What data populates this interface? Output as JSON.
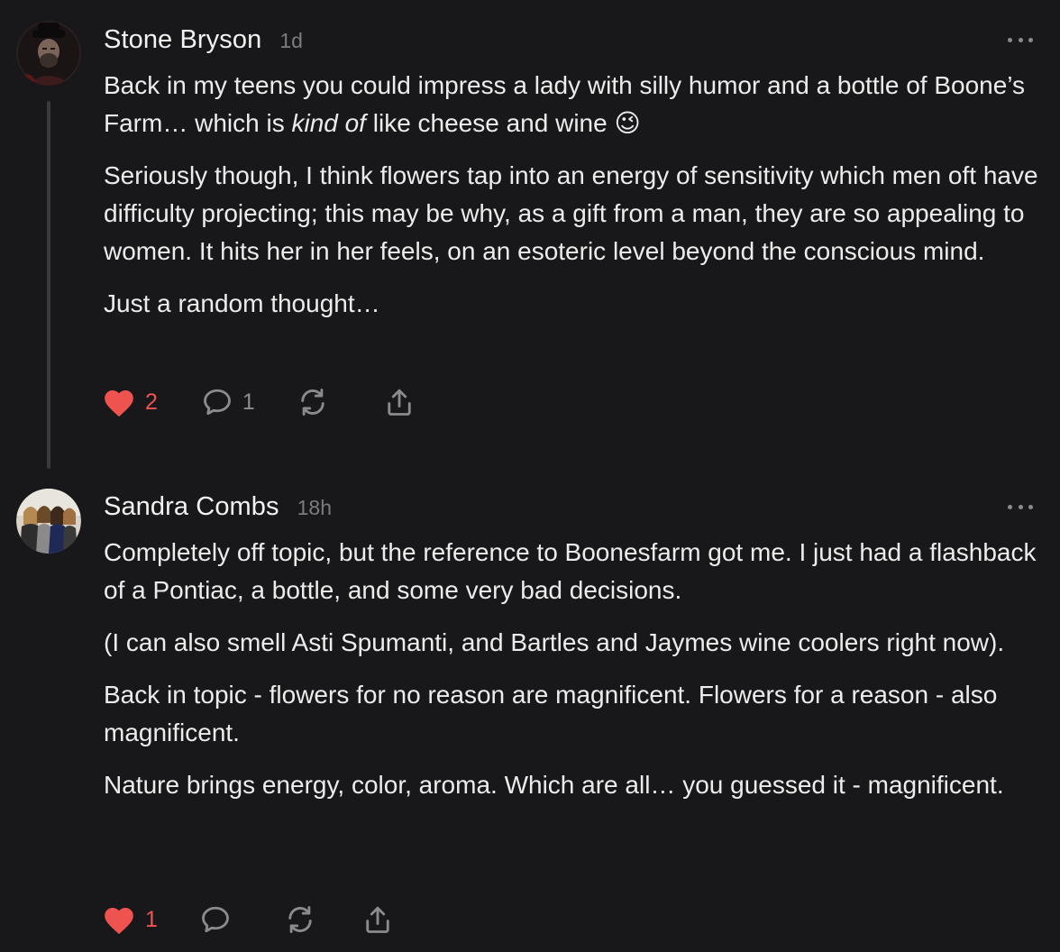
{
  "comments": [
    {
      "author": "Stone Bryson",
      "time": "1d",
      "paragraphs": [
        {
          "before": "Back in my teens you could impress a lady with silly humor and a bottle of Boone’s Farm… which is ",
          "italic": "kind of",
          "after": " like cheese and wine 😉"
        },
        "Seriously though, I think flowers tap into an energy of sensitivity which men oft have difficulty projecting; this may be why, as a gift from a man, they are so appealing to women. It hits her in her feels, on an esoteric level beyond the conscious mind.",
        "Just a random thought…"
      ],
      "likes": "2",
      "replies": "1",
      "liked": true
    },
    {
      "author": "Sandra Combs",
      "time": "18h",
      "paragraphs": [
        "Completely off topic, but the reference to Boonesfarm got me. I just had a flashback of a Pontiac, a bottle, and some very bad decisions.",
        "(I can also smell Asti Spumanti, and Bartles and Jaymes wine coolers right now).",
        "Back in topic - flowers for no reason are magnificent. Flowers for a reason - also magnificent.",
        "Nature brings energy, color, aroma. Which are all… you guessed it - magnificent."
      ],
      "likes": "1",
      "replies": "",
      "liked": true
    }
  ],
  "icons": {
    "like": "heart-icon",
    "reply": "speech-bubble-icon",
    "restack": "restack-icon",
    "share": "share-icon",
    "more": "more-dots-icon"
  },
  "colors": {
    "background": "#18181a",
    "text": "#ececec",
    "muted": "#8b8b8f",
    "like": "#ef5350",
    "thread_line": "#3a3a3c"
  }
}
